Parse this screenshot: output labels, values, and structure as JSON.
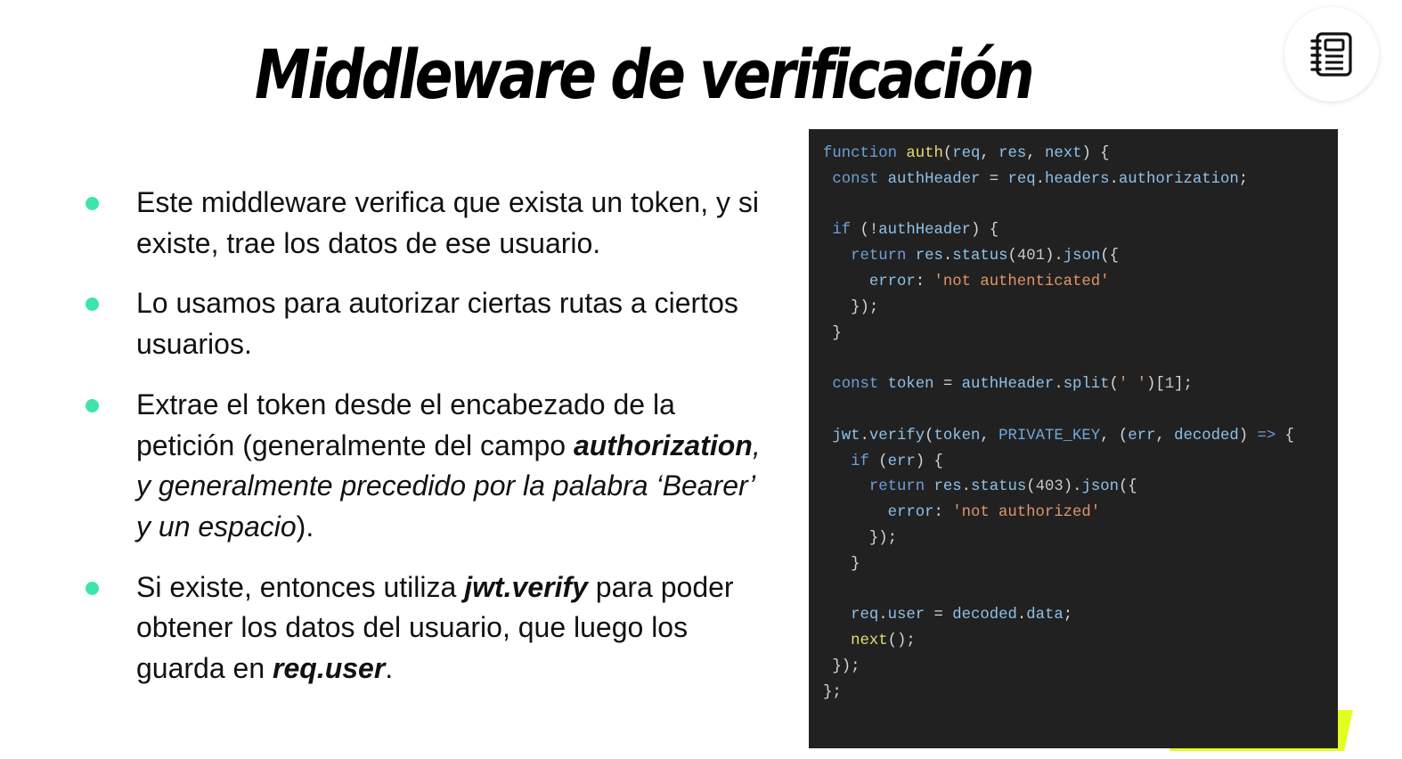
{
  "title": "Middleware de verificación",
  "icons": {
    "corner_badge": "notebook-icon",
    "bullet": "bullet-dot-icon"
  },
  "colors": {
    "bullet_dot": "#3de6a8",
    "code_background": "#212121",
    "accent": "#e2ff1f"
  },
  "bullets": [
    {
      "id": "token-check",
      "segments": [
        {
          "text": "Este middleware verifica que exista un token, y si existe, trae los datos de ese usuario.",
          "style": "normal"
        }
      ]
    },
    {
      "id": "authorize-routes",
      "segments": [
        {
          "text": "Lo usamos para autorizar ciertas rutas a ciertos usuarios.",
          "style": "normal"
        }
      ]
    },
    {
      "id": "extract-token",
      "segments": [
        {
          "text": "Extrae el token desde el encabezado de la petición (generalmente del campo ",
          "style": "normal"
        },
        {
          "text": "authorization",
          "style": "bold-italic"
        },
        {
          "text": ", y generalmente precedido por la palabra ‘Bearer’ y un espacio",
          "style": "italic"
        },
        {
          "text": ").",
          "style": "normal"
        }
      ]
    },
    {
      "id": "jwt-verify",
      "segments": [
        {
          "text": "Si existe, entonces utiliza ",
          "style": "normal"
        },
        {
          "text": "jwt.verify",
          "style": "bold-italic"
        },
        {
          "text": " para poder obtener los datos del usuario, que luego los guarda en ",
          "style": "normal"
        },
        {
          "text": "req.user",
          "style": "bold-italic"
        },
        {
          "text": ".",
          "style": "normal"
        }
      ]
    }
  ],
  "code": {
    "language": "javascript",
    "lines": [
      [
        {
          "t": "function",
          "k": "kw"
        },
        {
          "t": " ",
          "k": "pl"
        },
        {
          "t": "auth",
          "k": "fn"
        },
        {
          "t": "(",
          "k": "pl"
        },
        {
          "t": "req",
          "k": "pm"
        },
        {
          "t": ", ",
          "k": "pl"
        },
        {
          "t": "res",
          "k": "pm"
        },
        {
          "t": ", ",
          "k": "pl"
        },
        {
          "t": "next",
          "k": "pm"
        },
        {
          "t": ") {",
          "k": "pl"
        }
      ],
      [
        {
          "t": " ",
          "k": "pl"
        },
        {
          "t": "const",
          "k": "kw"
        },
        {
          "t": " ",
          "k": "pl"
        },
        {
          "t": "authHeader",
          "k": "pm"
        },
        {
          "t": " = ",
          "k": "pl"
        },
        {
          "t": "req",
          "k": "pm"
        },
        {
          "t": ".",
          "k": "pl"
        },
        {
          "t": "headers",
          "k": "pm"
        },
        {
          "t": ".",
          "k": "pl"
        },
        {
          "t": "authorization",
          "k": "pm"
        },
        {
          "t": ";",
          "k": "pl"
        }
      ],
      [],
      [
        {
          "t": " ",
          "k": "pl"
        },
        {
          "t": "if",
          "k": "kw"
        },
        {
          "t": " (!",
          "k": "pl"
        },
        {
          "t": "authHeader",
          "k": "pm"
        },
        {
          "t": ") {",
          "k": "pl"
        }
      ],
      [
        {
          "t": "   ",
          "k": "pl"
        },
        {
          "t": "return",
          "k": "kw"
        },
        {
          "t": " ",
          "k": "pl"
        },
        {
          "t": "res",
          "k": "pm"
        },
        {
          "t": ".",
          "k": "pl"
        },
        {
          "t": "status",
          "k": "pm"
        },
        {
          "t": "(",
          "k": "pl"
        },
        {
          "t": "401",
          "k": "nu"
        },
        {
          "t": ").",
          "k": "pl"
        },
        {
          "t": "json",
          "k": "pm"
        },
        {
          "t": "({",
          "k": "pl"
        }
      ],
      [
        {
          "t": "     ",
          "k": "pl"
        },
        {
          "t": "error",
          "k": "pm"
        },
        {
          "t": ": ",
          "k": "pl"
        },
        {
          "t": "'not authenticated'",
          "k": "st"
        }
      ],
      [
        {
          "t": "   });",
          "k": "pl"
        }
      ],
      [
        {
          "t": " }",
          "k": "pl"
        }
      ],
      [],
      [
        {
          "t": " ",
          "k": "pl"
        },
        {
          "t": "const",
          "k": "kw"
        },
        {
          "t": " ",
          "k": "pl"
        },
        {
          "t": "token",
          "k": "pm"
        },
        {
          "t": " = ",
          "k": "pl"
        },
        {
          "t": "authHeader",
          "k": "pm"
        },
        {
          "t": ".",
          "k": "pl"
        },
        {
          "t": "split",
          "k": "pm"
        },
        {
          "t": "(",
          "k": "pl"
        },
        {
          "t": "' '",
          "k": "st"
        },
        {
          "t": ")[",
          "k": "pl"
        },
        {
          "t": "1",
          "k": "nu"
        },
        {
          "t": "];",
          "k": "pl"
        }
      ],
      [],
      [
        {
          "t": " ",
          "k": "pl"
        },
        {
          "t": "jwt",
          "k": "pm"
        },
        {
          "t": ".",
          "k": "pl"
        },
        {
          "t": "verify",
          "k": "pm"
        },
        {
          "t": "(",
          "k": "pl"
        },
        {
          "t": "token",
          "k": "pm"
        },
        {
          "t": ", ",
          "k": "pl"
        },
        {
          "t": "PRIVATE_KEY",
          "k": "ct"
        },
        {
          "t": ", (",
          "k": "pl"
        },
        {
          "t": "err",
          "k": "pm"
        },
        {
          "t": ", ",
          "k": "pl"
        },
        {
          "t": "decoded",
          "k": "pm"
        },
        {
          "t": ") ",
          "k": "pl"
        },
        {
          "t": "=>",
          "k": "kw"
        },
        {
          "t": " {",
          "k": "pl"
        }
      ],
      [
        {
          "t": "   ",
          "k": "pl"
        },
        {
          "t": "if",
          "k": "kw"
        },
        {
          "t": " (",
          "k": "pl"
        },
        {
          "t": "err",
          "k": "pm"
        },
        {
          "t": ") {",
          "k": "pl"
        }
      ],
      [
        {
          "t": "     ",
          "k": "pl"
        },
        {
          "t": "return",
          "k": "kw"
        },
        {
          "t": " ",
          "k": "pl"
        },
        {
          "t": "res",
          "k": "pm"
        },
        {
          "t": ".",
          "k": "pl"
        },
        {
          "t": "status",
          "k": "pm"
        },
        {
          "t": "(",
          "k": "pl"
        },
        {
          "t": "403",
          "k": "nu"
        },
        {
          "t": ").",
          "k": "pl"
        },
        {
          "t": "json",
          "k": "pm"
        },
        {
          "t": "({",
          "k": "pl"
        }
      ],
      [
        {
          "t": "       ",
          "k": "pl"
        },
        {
          "t": "error",
          "k": "pm"
        },
        {
          "t": ": ",
          "k": "pl"
        },
        {
          "t": "'not authorized'",
          "k": "st"
        }
      ],
      [
        {
          "t": "     });",
          "k": "pl"
        }
      ],
      [
        {
          "t": "   }",
          "k": "pl"
        }
      ],
      [],
      [
        {
          "t": "   ",
          "k": "pl"
        },
        {
          "t": "req",
          "k": "pm"
        },
        {
          "t": ".",
          "k": "pl"
        },
        {
          "t": "user",
          "k": "pm"
        },
        {
          "t": " = ",
          "k": "pl"
        },
        {
          "t": "decoded",
          "k": "pm"
        },
        {
          "t": ".",
          "k": "pl"
        },
        {
          "t": "data",
          "k": "pm"
        },
        {
          "t": ";",
          "k": "pl"
        }
      ],
      [
        {
          "t": "   ",
          "k": "pl"
        },
        {
          "t": "next",
          "k": "fn"
        },
        {
          "t": "();",
          "k": "pl"
        }
      ],
      [
        {
          "t": " });",
          "k": "pl"
        }
      ],
      [
        {
          "t": "};",
          "k": "pl"
        }
      ]
    ]
  }
}
